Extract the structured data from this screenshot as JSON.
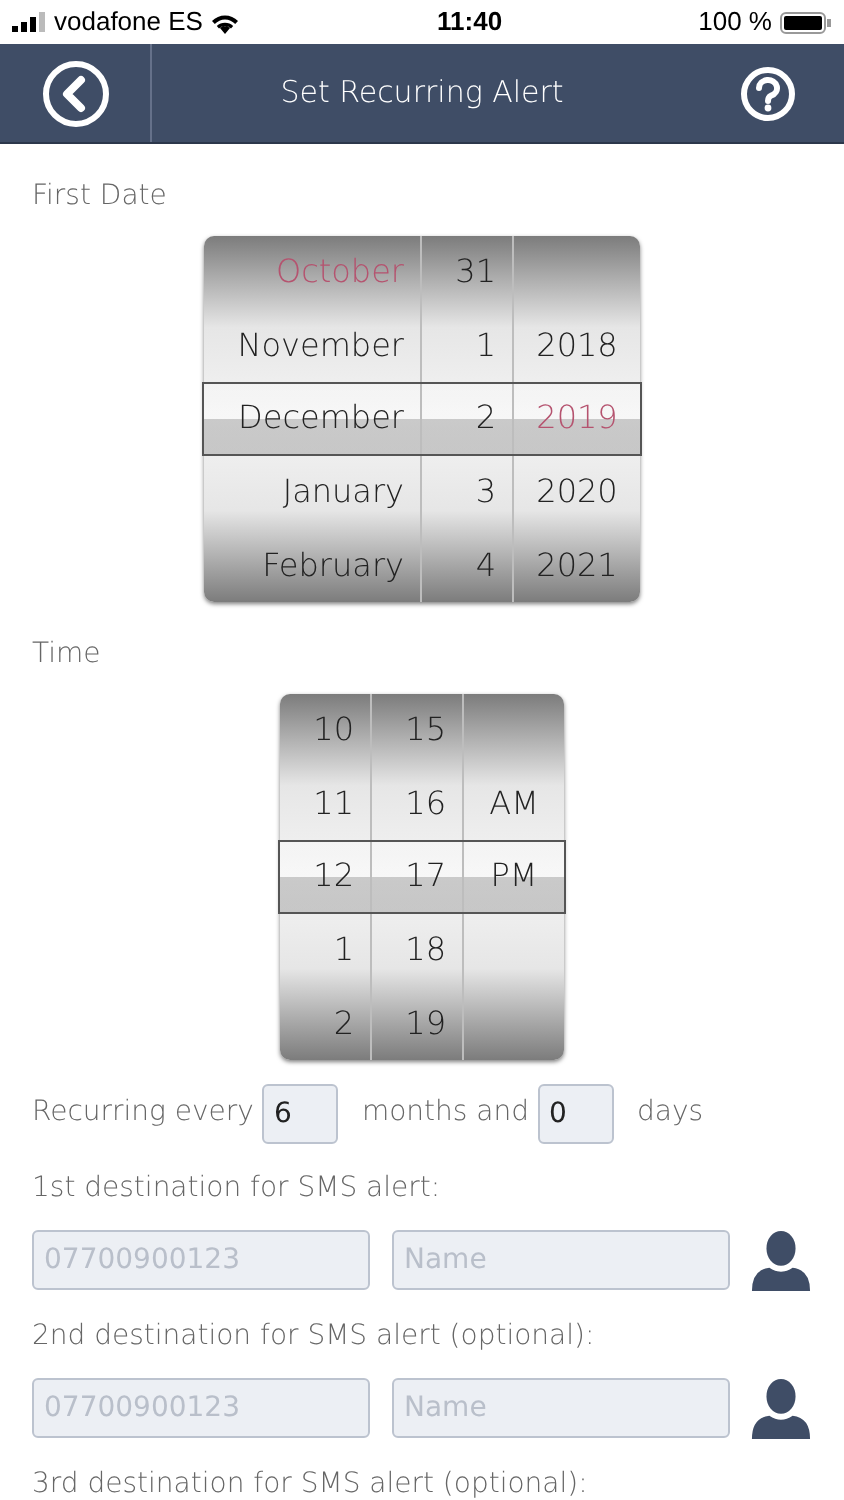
{
  "status_bar": {
    "carrier": "vodafone ES",
    "time": "11:40",
    "battery": "100 %"
  },
  "header": {
    "title": "Set Recurring Alert"
  },
  "first_date": {
    "label": "First Date",
    "rows": [
      {
        "selected": false,
        "cells": [
          {
            "kind": "value",
            "text": "October",
            "accent": true
          },
          {
            "kind": "value",
            "text": "31",
            "accent": false
          },
          {
            "kind": "blank"
          }
        ]
      },
      {
        "selected": false,
        "cells": [
          {
            "kind": "value",
            "text": "November",
            "accent": false
          },
          {
            "kind": "value",
            "text": "1",
            "accent": false
          },
          {
            "kind": "value",
            "text": "2018",
            "accent": false
          }
        ]
      },
      {
        "selected": true,
        "cells": [
          {
            "kind": "value",
            "text": "December",
            "accent": false
          },
          {
            "kind": "value",
            "text": "2",
            "accent": false
          },
          {
            "kind": "value",
            "text": "2019",
            "accent": true
          }
        ]
      },
      {
        "selected": false,
        "cells": [
          {
            "kind": "value",
            "text": "January",
            "accent": false
          },
          {
            "kind": "value",
            "text": "3",
            "accent": false
          },
          {
            "kind": "value",
            "text": "2020",
            "accent": false
          }
        ]
      },
      {
        "selected": false,
        "cells": [
          {
            "kind": "value",
            "text": "February",
            "accent": false
          },
          {
            "kind": "value",
            "text": "4",
            "accent": false
          },
          {
            "kind": "value",
            "text": "2021",
            "accent": false
          }
        ]
      }
    ]
  },
  "time": {
    "label": "Time",
    "rows": [
      {
        "selected": false,
        "cells": [
          {
            "kind": "value",
            "text": "10",
            "accent": false
          },
          {
            "kind": "value",
            "text": "15",
            "accent": false
          },
          {
            "kind": "blank"
          }
        ]
      },
      {
        "selected": false,
        "cells": [
          {
            "kind": "value",
            "text": "11",
            "accent": false
          },
          {
            "kind": "value",
            "text": "16",
            "accent": false
          },
          {
            "kind": "value",
            "text": "AM",
            "accent": false
          }
        ]
      },
      {
        "selected": true,
        "cells": [
          {
            "kind": "value",
            "text": "12",
            "accent": false
          },
          {
            "kind": "value",
            "text": "17",
            "accent": false
          },
          {
            "kind": "value",
            "text": "PM",
            "accent": false
          }
        ]
      },
      {
        "selected": false,
        "cells": [
          {
            "kind": "value",
            "text": "1",
            "accent": false
          },
          {
            "kind": "value",
            "text": "18",
            "accent": false
          },
          {
            "kind": "blank"
          }
        ]
      },
      {
        "selected": false,
        "cells": [
          {
            "kind": "value",
            "text": "2",
            "accent": false
          },
          {
            "kind": "value",
            "text": "19",
            "accent": false
          },
          {
            "kind": "blank"
          }
        ]
      }
    ]
  },
  "recurrence": {
    "prefix": "Recurring every",
    "months": "6",
    "middle": "months and",
    "days": "0",
    "suffix": "days"
  },
  "destinations": [
    {
      "label": "1st destination for SMS alert:",
      "phone_placeholder": "07700900123",
      "name_placeholder": "Name"
    },
    {
      "label": "2nd destination for SMS alert (optional):",
      "phone_placeholder": "07700900123",
      "name_placeholder": "Name"
    },
    {
      "label": "3rd destination for SMS alert (optional):"
    }
  ]
}
